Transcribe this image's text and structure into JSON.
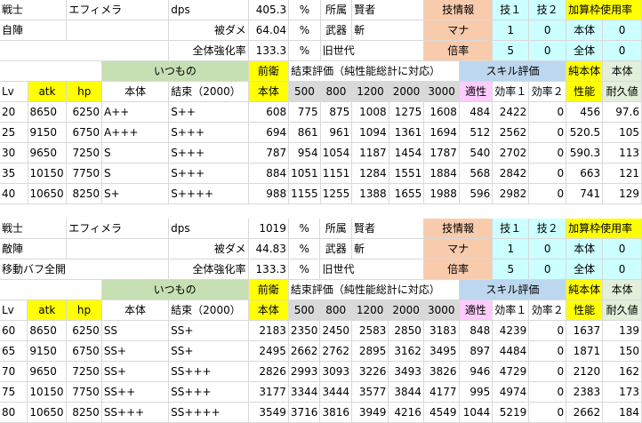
{
  "sections": [
    {
      "info": {
        "class": "戦士",
        "name": "エフィメラ",
        "dps_label": "dps",
        "dps_value": "405.3",
        "pct": "%",
        "affil_label": "所属",
        "affil_value": "賢者",
        "skill_info": "技情報",
        "skill1": "技１",
        "skill2": "技２",
        "addcap": "加算枠使用率",
        "row2_a": "自陣",
        "row2_b": "",
        "dmg_label": "被ダメ",
        "dmg_value": "64.04",
        "pct2": "%",
        "weapon_label": "武器",
        "weapon_value": "斬",
        "mana_label": "マナ",
        "mana1": "1",
        "mana2": "0",
        "base_label": "本体",
        "base_value": "0",
        "row3_a": "",
        "strength_label": "全体強化率",
        "strength_value": "133.3",
        "pct3": "%",
        "gen_label": "旧世代",
        "mult_label": "倍率",
        "mult1": "5",
        "mult2": "0",
        "all_label": "全体",
        "all_value": "0"
      },
      "group_header": {
        "usual": "いつもの",
        "front": "前衛",
        "bond_eval": "結束評価（純性能総計に対応）",
        "skill_eval": "スキル評価",
        "pure": "純本体",
        "body": "本体"
      },
      "columns": {
        "lv": "Lv",
        "atk": "atk",
        "hp": "hp",
        "body": "本体",
        "bond": "結束（2000）",
        "body2": "本体",
        "b500": "500",
        "b800": "800",
        "b1200": "1200",
        "b2000": "2000",
        "b3000": "3000",
        "fit": "適性",
        "eff1": "効率１",
        "eff2": "効率２",
        "perf": "性能",
        "dur": "耐久値"
      },
      "rows": [
        [
          "20",
          "8650",
          "6250",
          "A++",
          "S++",
          "608",
          "775",
          "875",
          "1008",
          "1275",
          "1608",
          "484",
          "2422",
          "0",
          "456",
          "97.6"
        ],
        [
          "25",
          "9150",
          "6750",
          "A+++",
          "S+++",
          "694",
          "861",
          "961",
          "1094",
          "1361",
          "1694",
          "512",
          "2562",
          "0",
          "520.5",
          "105"
        ],
        [
          "30",
          "9650",
          "7250",
          "S",
          "S+++",
          "787",
          "954",
          "1054",
          "1187",
          "1454",
          "1787",
          "540",
          "2702",
          "0",
          "590.3",
          "113"
        ],
        [
          "35",
          "10150",
          "7750",
          "S",
          "S+++",
          "884",
          "1051",
          "1151",
          "1284",
          "1551",
          "1884",
          "568",
          "2842",
          "0",
          "663",
          "121"
        ],
        [
          "40",
          "10650",
          "8250",
          "S+",
          "S++++",
          "988",
          "1155",
          "1255",
          "1388",
          "1655",
          "1988",
          "596",
          "2982",
          "0",
          "741",
          "129"
        ]
      ]
    },
    {
      "info": {
        "class": "戦士",
        "name": "エフィメラ",
        "dps_label": "dps",
        "dps_value": "1019",
        "pct": "%",
        "affil_label": "所属",
        "affil_value": "賢者",
        "skill_info": "技情報",
        "skill1": "技１",
        "skill2": "技２",
        "addcap": "加算枠使用率",
        "row2_a": "敵陣",
        "row2_b": "",
        "dmg_label": "被ダメ",
        "dmg_value": "44.83",
        "pct2": "%",
        "weapon_label": "武器",
        "weapon_value": "斬",
        "mana_label": "マナ",
        "mana1": "1",
        "mana2": "0",
        "base_label": "本体",
        "base_value": "0",
        "row3_a": "移動バフ全開",
        "strength_label": "全体強化率",
        "strength_value": "133.3",
        "pct3": "%",
        "gen_label": "旧世代",
        "mult_label": "倍率",
        "mult1": "5",
        "mult2": "0",
        "all_label": "全体",
        "all_value": "0"
      },
      "group_header": {
        "usual": "いつもの",
        "front": "前衛",
        "bond_eval": "結束評価（純性能総計に対応）",
        "skill_eval": "スキル評価",
        "pure": "純本体",
        "body": "本体"
      },
      "columns": {
        "lv": "Lv",
        "atk": "atk",
        "hp": "hp",
        "body": "本体",
        "bond": "結束（2000）",
        "body2": "本体",
        "b500": "500",
        "b800": "800",
        "b1200": "1200",
        "b2000": "2000",
        "b3000": "3000",
        "fit": "適性",
        "eff1": "効率１",
        "eff2": "効率２",
        "perf": "性能",
        "dur": "耐久値"
      },
      "rows": [
        [
          "60",
          "8650",
          "6250",
          "SS",
          "SS+",
          "2183",
          "2350",
          "2450",
          "2583",
          "2850",
          "3183",
          "848",
          "4239",
          "0",
          "1637",
          "139"
        ],
        [
          "65",
          "9150",
          "6750",
          "SS+",
          "SS+",
          "2495",
          "2662",
          "2762",
          "2895",
          "3162",
          "3495",
          "897",
          "4484",
          "0",
          "1871",
          "150"
        ],
        [
          "70",
          "9650",
          "7250",
          "SS+",
          "SS+++",
          "2826",
          "2993",
          "3093",
          "3226",
          "3493",
          "3826",
          "946",
          "4729",
          "0",
          "2120",
          "162"
        ],
        [
          "75",
          "10150",
          "7750",
          "SS++",
          "SS+++",
          "3177",
          "3344",
          "3444",
          "3577",
          "3844",
          "4177",
          "995",
          "4974",
          "0",
          "2383",
          "173"
        ],
        [
          "80",
          "10650",
          "8250",
          "SS+++",
          "SS++++",
          "3549",
          "3716",
          "3816",
          "3949",
          "4216",
          "4549",
          "1044",
          "5219",
          "0",
          "2662",
          "184"
        ]
      ]
    }
  ]
}
